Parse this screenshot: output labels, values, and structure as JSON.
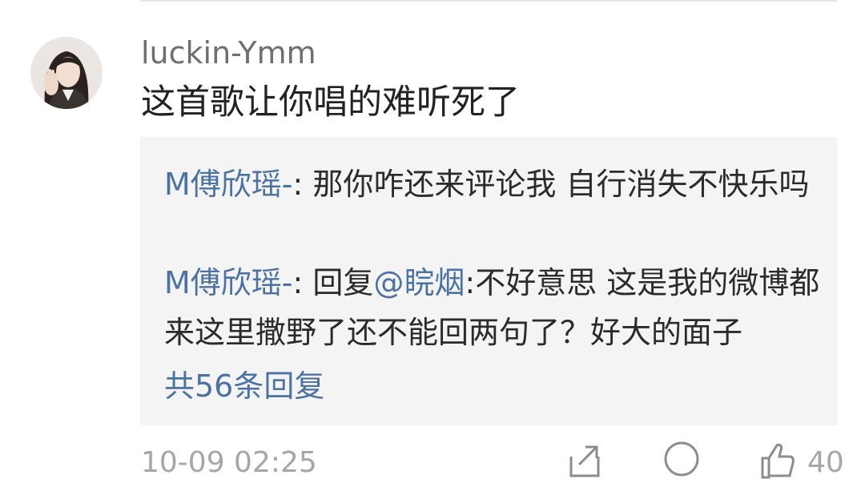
{
  "comment": {
    "username": "luckin-Ymm",
    "text": "这首歌让你唱的难听死了",
    "timestamp": "10-09 02:25",
    "like_count": "40"
  },
  "replies": [
    {
      "author": "M傅欣瑶-",
      "separator": ": ",
      "text": "那你咋还来评论我 自行消失不快乐吗"
    },
    {
      "author": "M傅欣瑶-",
      "separator": ": ",
      "prefix": "回复",
      "mention": "@睆烟",
      "text": ":不好意思 这是我的微博都来这里撒野了还不能回两句了？好大的面子"
    }
  ],
  "more_replies_label": "共56条回复",
  "icons": {
    "avatar": "user-avatar",
    "share": "share-icon",
    "comment": "comment-icon",
    "like": "thumbs-up-icon"
  },
  "colors": {
    "link": "#4a73a3",
    "reply_bg": "#f4f4f4",
    "muted": "#a6a6a6"
  }
}
